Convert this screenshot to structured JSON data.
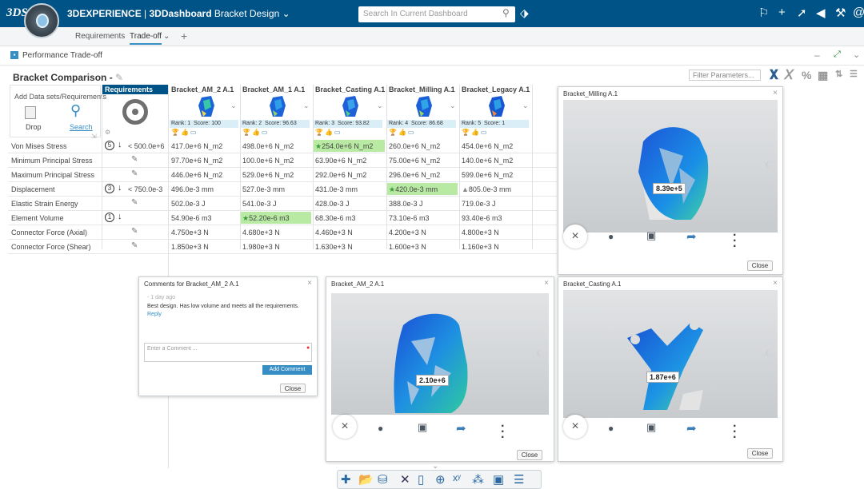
{
  "header": {
    "logo": "3DS",
    "brand": "3DEXPERIENCE",
    "separator": " | ",
    "app": "3DDashboard",
    "dashboard": "Bracket Design",
    "search_placeholder": "Search In Current Dashboard"
  },
  "tabs": [
    {
      "label": "Requirements"
    },
    {
      "label": "Trade-off"
    }
  ],
  "section": {
    "title": "Performance Trade-off"
  },
  "comparison": {
    "title": "Bracket Comparison -",
    "filter_placeholder": "Filter Parameters...",
    "toolbar_percent": "%"
  },
  "add_panel": {
    "title": "Add Data sets/Requirements",
    "drop": "Drop",
    "search": "Search"
  },
  "requirements_header": "Requirements",
  "columns": [
    {
      "name": "Bracket_AM_2 A.1",
      "rank": "Rank: 1",
      "score": "Score: 100"
    },
    {
      "name": "Bracket_AM_1 A.1",
      "rank": "Rank: 2",
      "score": "Score: 96.63"
    },
    {
      "name": "Bracket_Casting A.1",
      "rank": "Rank: 3",
      "score": "Score: 93.82"
    },
    {
      "name": "Bracket_Milling A.1",
      "rank": "Rank: 4",
      "score": "Score: 86.68"
    },
    {
      "name": "Bracket_Legacy A.1",
      "rank": "Rank: 5",
      "score": "Score: 1"
    }
  ],
  "rows": [
    {
      "param": "Von Mises Stress",
      "priority": "5",
      "req": "< 500.0e+6",
      "values": [
        "417.0e+6 N_m2",
        "498.0e+6 N_m2",
        "254.0e+6 N_m2",
        "260.0e+6 N_m2",
        "454.0e+6 N_m2"
      ],
      "best": 2
    },
    {
      "param": "Minimum Principal Stress",
      "priority": "",
      "req": "",
      "values": [
        "97.70e+6 N_m2",
        "100.0e+6 N_m2",
        "63.90e+6 N_m2",
        "75.00e+6 N_m2",
        "140.0e+6 N_m2"
      ],
      "best": -1
    },
    {
      "param": "Maximum Principal Stress",
      "priority": "",
      "req": "",
      "values": [
        "446.0e+6 N_m2",
        "529.0e+6 N_m2",
        "292.0e+6 N_m2",
        "296.0e+6 N_m2",
        "599.0e+6 N_m2"
      ],
      "best": -1
    },
    {
      "param": "Displacement",
      "priority": "3",
      "req": "< 750.0e-3",
      "values": [
        "496.0e-3 mm",
        "527.0e-3 mm",
        "431.0e-3 mm",
        "420.0e-3 mm",
        "805.0e-3 mm"
      ],
      "best": 3
    },
    {
      "param": "Elastic Strain Energy",
      "priority": "",
      "req": "",
      "values": [
        "502.0e-3 J",
        "541.0e-3 J",
        "428.0e-3 J",
        "388.0e-3 J",
        "719.0e-3 J"
      ],
      "best": -1
    },
    {
      "param": "Element Volume",
      "priority": "1",
      "req": "",
      "values": [
        "54.90e-6 m3",
        "52.20e-6 m3",
        "68.30e-6 m3",
        "73.10e-6 m3",
        "93.40e-6 m3"
      ],
      "best": 1
    },
    {
      "param": "Connector Force (Axial)",
      "priority": "",
      "req": "",
      "values": [
        "4.750e+3 N",
        "4.680e+3 N",
        "4.460e+3 N",
        "4.200e+3 N",
        "4.800e+3 N"
      ],
      "best": -1
    },
    {
      "param": "Connector Force (Shear)",
      "priority": "",
      "req": "",
      "values": [
        "1.850e+3 N",
        "1.980e+3 N",
        "1.630e+3 N",
        "1.600e+3 N",
        "1.160e+3 N"
      ],
      "best": -1
    }
  ],
  "comments": {
    "title": "Comments for Bracket_AM_2 A.1",
    "meta": "- 1 day ago",
    "text": "Best design. Has low volume and meets all the requirements.",
    "reply": "Reply",
    "input_placeholder": "Enter a Comment ...",
    "add": "Add Comment",
    "close": "Close"
  },
  "viewers": [
    {
      "title": "Bracket_Milling A.1",
      "value": "8.39e+5",
      "close": "Close"
    },
    {
      "title": "Bracket_AM_2 A.1",
      "value": "2.10e+6",
      "close": "Close"
    },
    {
      "title": "Bracket_Casting A.1",
      "value": "1.87e+6",
      "close": "Close"
    }
  ],
  "colors": {
    "accent": "#005386",
    "highlight": "#b8eaa4",
    "rank_bg": "#d9eef7"
  }
}
